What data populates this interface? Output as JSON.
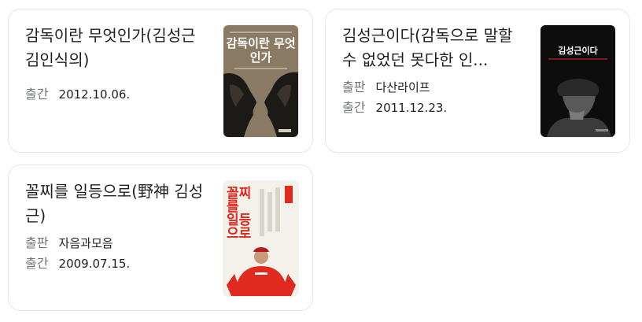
{
  "books": [
    {
      "title": "감독이란 무엇인가(김성근 김인식의)",
      "meta": [
        {
          "key": "출간",
          "value": "2012.10.06."
        }
      ],
      "cover": {
        "text": "감독이란 무엇인가",
        "icon": "book-cover-two-faces"
      }
    },
    {
      "title": "김성근이다(감독으로 말할 수 없었던 못다한 인...",
      "meta": [
        {
          "key": "출판",
          "value": "다산라이프"
        },
        {
          "key": "출간",
          "value": "2011.12.23."
        }
      ],
      "cover": {
        "text": "김성근이다",
        "icon": "book-cover-portrait"
      }
    },
    {
      "title": "꼴찌를 일등으로(野神 김성근)",
      "meta": [
        {
          "key": "출판",
          "value": "자음과모음"
        },
        {
          "key": "출간",
          "value": "2009.07.15."
        }
      ],
      "cover": {
        "text": "꼴찌를 일등으로",
        "icon": "book-cover-red-uniform"
      }
    }
  ],
  "colors": {
    "title": "#1f1f1f",
    "meta_key": "#70757a",
    "card_border": "#e6e6e6",
    "cover3_red": "#e02a1f"
  }
}
